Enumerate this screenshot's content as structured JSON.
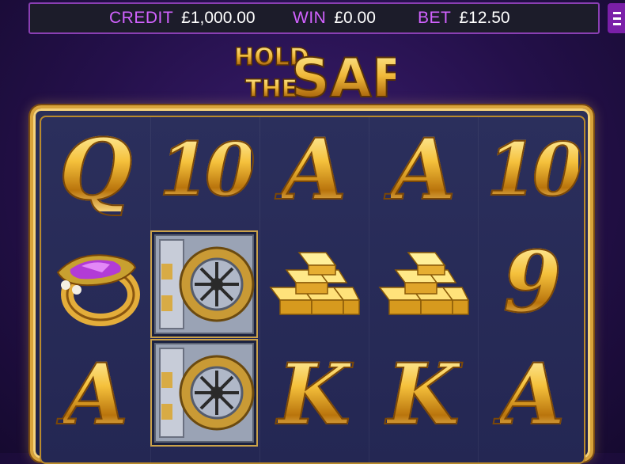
{
  "topbar": {
    "credit_label": "CREDIT",
    "credit_value": "£1,000.00",
    "win_label": "WIN",
    "win_value": "£0.00",
    "bet_label": "BET",
    "bet_value": "£12.50"
  },
  "menu": {
    "icon": "hamburger-menu-icon"
  },
  "logo": {
    "line1": "HOLD",
    "line2": "THE",
    "line3": "SAFE"
  },
  "reels": {
    "rows": [
      [
        "Q",
        "10",
        "A",
        "A",
        "10"
      ],
      [
        "ring",
        "safe",
        "gold",
        "gold",
        "9"
      ],
      [
        "A",
        "safe",
        "K",
        "K",
        "A"
      ]
    ]
  },
  "colors": {
    "label_purple": "#d262ff",
    "frame_gold": "#d8a33a",
    "menu_purple": "#7a1fa8"
  }
}
